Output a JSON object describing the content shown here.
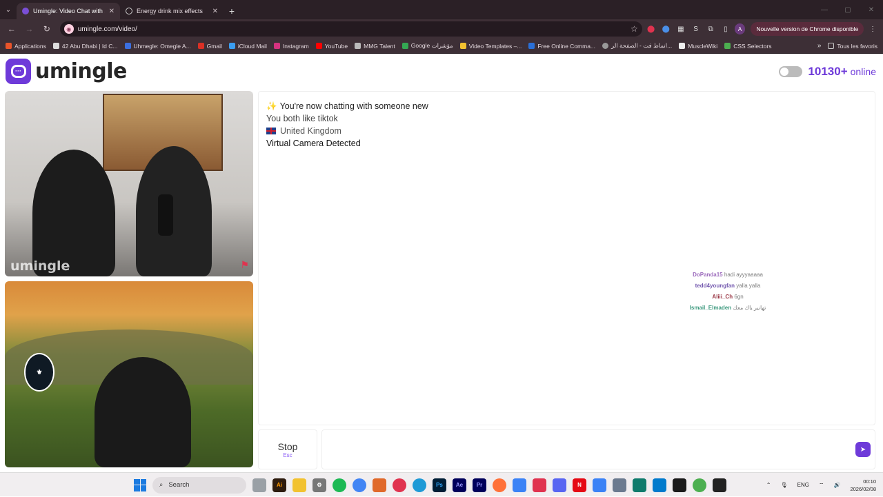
{
  "browser": {
    "tabs": [
      {
        "title": "Umingle: Video Chat with S",
        "active": true
      },
      {
        "title": "Energy drink mix effects",
        "active": false
      }
    ],
    "url": "umingle.com/video/",
    "update_button": "Nouvelle version de Chrome disponible",
    "profile_initial": "A",
    "bookmarks": [
      "Applications",
      "42 Abu Dhabi | Id C...",
      "Uhmegle: Omegle A...",
      "Gmail",
      "iCloud Mail",
      "Instagram",
      "YouTube",
      "MMG Talent",
      "Google مؤشرات",
      "Video Templates –...",
      "Free Online Comma...",
      "انماط فت - الصفحة الر...",
      "MuscleWiki",
      "CSS Selectors"
    ],
    "all_bookmarks": "Tous les favoris"
  },
  "site": {
    "logo_text": "umingle",
    "online_count": "10130+",
    "online_label": "online",
    "video_watermark": "umingle"
  },
  "chat": {
    "intro": "You're now chatting with someone new",
    "interest": "You both like tiktok",
    "country": "United Kingdom",
    "warning": "Virtual Camera Detected",
    "overlay_messages": [
      {
        "name": "DoPanda15",
        "text": "hadi ayyyaaaaa",
        "color": "#8a4fb0"
      },
      {
        "name": "tedd4youngfan",
        "text": "yalla yalla",
        "color": "#5a3aa0"
      },
      {
        "name": "Aliii_Ch",
        "text": "6gn",
        "color": "#8b1a2a"
      },
      {
        "name": "Ismail_Elmaden",
        "text": "تهانير ياك معك",
        "color": "#1f8a6b"
      }
    ]
  },
  "controls": {
    "stop_label": "Stop",
    "stop_shortcut": "Esc"
  },
  "taskbar": {
    "search_label": "Search",
    "language": "ENG",
    "time": "00:10",
    "date": "2026/02/08"
  }
}
